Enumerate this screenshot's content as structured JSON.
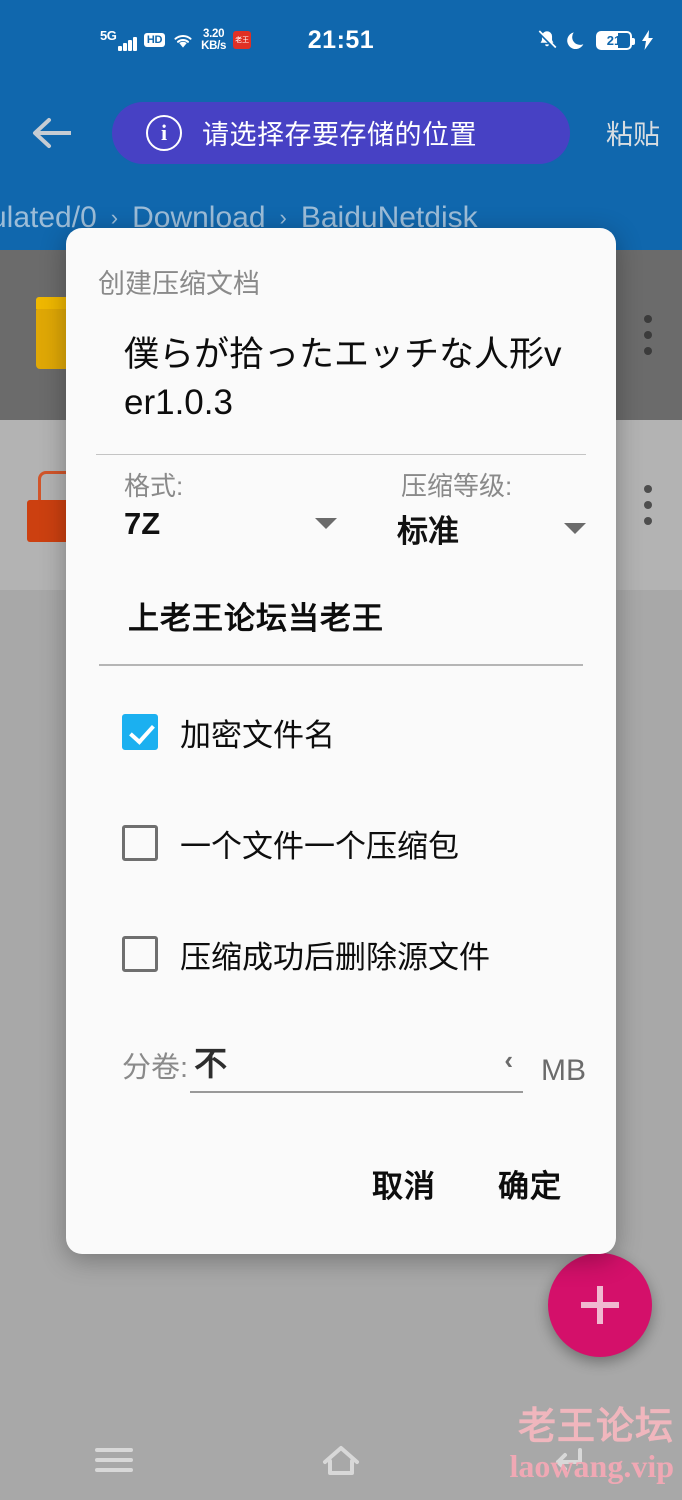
{
  "statusbar": {
    "network_type": "5G",
    "hd_label": "HD",
    "speed_value": "3.20",
    "speed_unit": "KB/s",
    "app_badge_label": "老王",
    "clock": "21:51",
    "battery_level": "21",
    "icons": [
      "signal-bars-icon",
      "hd-icon",
      "wifi-icon",
      "network-speed-icon",
      "app-badge-icon",
      "bell-muted-icon",
      "moon-dnd-icon",
      "battery-icon",
      "charging-bolt-icon"
    ]
  },
  "toolbar": {
    "back_icon": "arrow-left-icon",
    "snackbar": {
      "icon": "info-circle-icon",
      "message": "请选择存要存储的位置"
    },
    "paste_label": "粘贴"
  },
  "breadcrumb": {
    "segments": [
      "ulated/0",
      "Download",
      "BaiduNetdisk"
    ],
    "separator": "›"
  },
  "filelist": {
    "rows": [
      {
        "icon": "folder-icon",
        "selected": true,
        "overflow_icon": "more-vertical-icon"
      },
      {
        "icon": "archive-file-icon",
        "selected": false,
        "overflow_icon": "more-vertical-icon"
      }
    ]
  },
  "fab": {
    "icon": "plus-icon",
    "color": "#d4106a"
  },
  "watermark": {
    "line1": "老王论坛",
    "line2": "laowang.vip"
  },
  "navbar": {
    "items": [
      {
        "name": "recents",
        "icon": "hamburger-icon"
      },
      {
        "name": "home",
        "icon": "home-icon"
      },
      {
        "name": "back",
        "icon": "back-arrow-icon"
      }
    ]
  },
  "dialog": {
    "title": "创建压缩文档",
    "filename": "僕らが拾ったエッチな人形ver1.0.3",
    "format": {
      "label": "格式:",
      "value": "7Z",
      "caret_icon": "chevron-down-icon"
    },
    "level": {
      "label": "压缩等级:",
      "value": "标准",
      "caret_icon": "chevron-down-icon"
    },
    "password": "上老王论坛当老王",
    "checkboxes": [
      {
        "label": "加密文件名",
        "checked": true
      },
      {
        "label": "一个文件一个压缩包",
        "checked": false
      },
      {
        "label": "压缩成功后删除源文件",
        "checked": false
      }
    ],
    "split": {
      "label": "分卷:",
      "value": "不",
      "chevron": "‹",
      "unit": "MB"
    },
    "cancel_label": "取消",
    "confirm_label": "确定",
    "accent_color": "#1bb0f0"
  }
}
